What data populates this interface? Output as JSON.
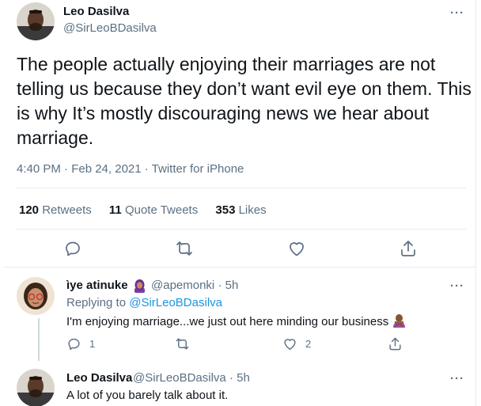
{
  "main_tweet": {
    "author_name": "Leo Dasilva",
    "author_handle": "@SirLeoBDasilva",
    "text": "The people actually enjoying their marriages are not telling us because they don’t want evil eye on them. This is why It’s mostly discouraging news we hear about marriage.",
    "timestamp": "4:40 PM · Feb 24, 2021 · Twitter for iPhone",
    "stats": {
      "retweets_count": "120",
      "retweets_label": "Retweets",
      "quotes_count": "11",
      "quotes_label": "Quote Tweets",
      "likes_count": "353",
      "likes_label": "Likes"
    },
    "actions": [
      "reply-icon",
      "retweet-icon",
      "like-icon",
      "share-icon"
    ]
  },
  "replies": [
    {
      "author_name": "ìye atinuke",
      "author_emoji": "woman-with-headscarf-emoji",
      "author_handle": "@apemonki",
      "time": "· 5h",
      "replying_to_label": "Replying to",
      "replying_to_handle": "@SirLeoBDasilva",
      "text": "I'm enjoying marriage...we just out here minding our business",
      "text_emoji": "person-gesturing-no-emoji",
      "reply_count": "1",
      "retweet_count": "",
      "like_count": "2"
    },
    {
      "author_name": "Leo Dasilva",
      "author_handle": "@SirLeoBDasilva",
      "time": "· 5h",
      "text": "A lot of you barely talk about it."
    }
  ],
  "colors": {
    "text": "#0f1419",
    "secondary": "#5b7083",
    "link": "#1b95e0",
    "divider": "#e6ecf0"
  }
}
